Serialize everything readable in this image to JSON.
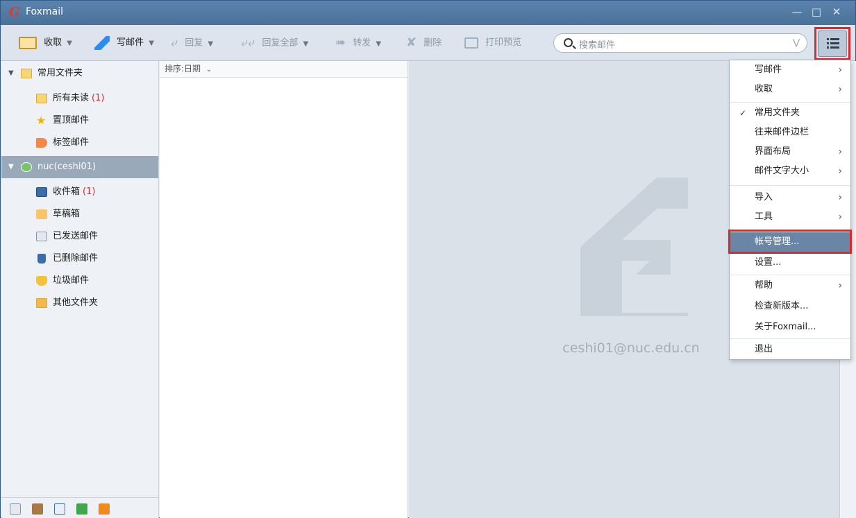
{
  "window": {
    "title": "Foxmail",
    "logo": "G"
  },
  "toolbar": {
    "receive": "收取",
    "compose": "写邮件",
    "reply": "回复",
    "reply_all": "回复全部",
    "forward": "转发",
    "delete": "删除",
    "print_preview": "打印预览"
  },
  "search": {
    "placeholder": "搜索邮件"
  },
  "sidebar": {
    "common_folder": "常用文件夹",
    "all_unread": "所有未读",
    "all_unread_count": "(1)",
    "pinned": "置顶邮件",
    "tagged": "标签邮件",
    "account": "nuc(ceshi01)",
    "inbox": "收件箱",
    "inbox_count": "(1)",
    "drafts": "草稿箱",
    "sent": "已发送邮件",
    "deleted": "已删除邮件",
    "junk": "垃圾邮件",
    "other": "其他文件夹"
  },
  "maillist": {
    "sort_label": "排序:日期"
  },
  "preview": {
    "email": "ceshi01@nuc.edu.cn"
  },
  "menu": {
    "compose": "写邮件",
    "receive": "收取",
    "common_folder": "常用文件夹",
    "contacts_sidebar": "往来邮件边栏",
    "layout": "界面布局",
    "font_size": "邮件文字大小",
    "import": "导入",
    "tools": "工具",
    "account_manage": "帐号管理...",
    "settings": "设置...",
    "help": "帮助",
    "check_update": "检查新版本...",
    "about": "关于Foxmail...",
    "exit": "退出"
  },
  "colors": {
    "accent": "#e0252b",
    "titlebar": "#4a7299",
    "highlight": "#6a86a6"
  }
}
